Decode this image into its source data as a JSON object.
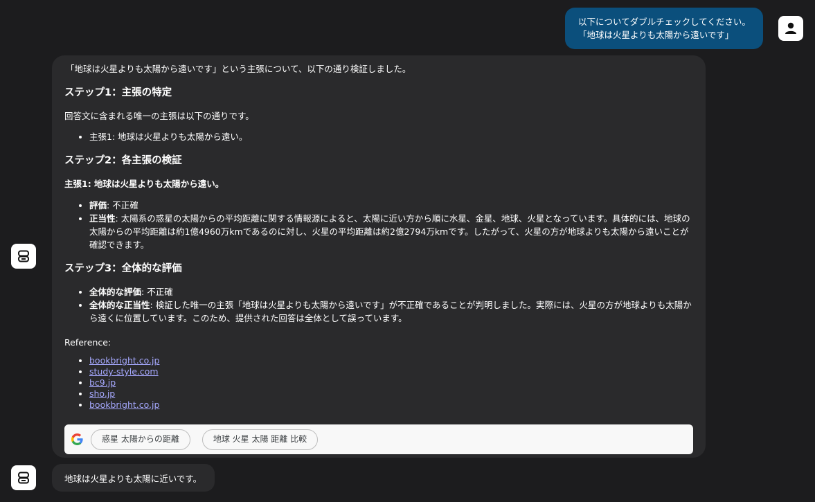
{
  "user_message": {
    "lines": [
      "以下についてダブルチェックしてください。",
      "「地球は火星よりも太陽から遠いです」"
    ]
  },
  "bot_response": {
    "intro": "「地球は火星よりも太陽から遠いです」という主張について、以下の通り検証しました。",
    "step1": {
      "heading": "ステップ1：主張の特定",
      "text": "回答文に含まれる唯一の主張は以下の通りです。",
      "items": [
        "主張1: 地球は火星よりも太陽から遠い。"
      ]
    },
    "step2": {
      "heading": "ステップ2：各主張の検証",
      "claim_heading": "主張1: 地球は火星よりも太陽から遠い。",
      "rating_label": "評価",
      "rating_value": ": 不正確",
      "justification_label": "正当性",
      "justification_value": ": 太陽系の惑星の太陽からの平均距離に関する情報源によると、太陽に近い方から順に水星、金星、地球、火星となっています。具体的には、地球の太陽からの平均距離は約1億4960万kmであるのに対し、火星の平均距離は約2億2794万kmです。したがって、火星の方が地球よりも太陽から遠いことが確認できます。"
    },
    "step3": {
      "heading": "ステップ3：全体的な評価",
      "rating_label": "全体的な評価",
      "rating_value": ": 不正確",
      "justification_label": "全体的な正当性",
      "justification_value": ": 検証した唯一の主張「地球は火星よりも太陽から遠いです」が不正確であることが判明しました。実際には、火星の方が地球よりも太陽から遠くに位置しています。このため、提供された回答は全体として誤っています。"
    },
    "reference_label": "Reference:",
    "references": [
      "bookbright.co.jp",
      "study-style.com",
      "bc9.jp",
      "sho.jp",
      "bookbright.co.jp"
    ],
    "search_suggestions": [
      "惑星 太陽からの距離",
      "地球 火星 太陽 距離 比較"
    ]
  },
  "bot_response_2": {
    "text": "地球は火星よりも太陽に近いです。"
  },
  "colors": {
    "background": "#1c1c1e",
    "bot_bubble": "#2a2a2c",
    "user_bubble": "#0b4f7c",
    "link": "#a6a9ff"
  },
  "icons": {
    "user_avatar": "person-icon",
    "bot_avatar": "robot-icon",
    "search_logo": "google-logo-icon"
  }
}
